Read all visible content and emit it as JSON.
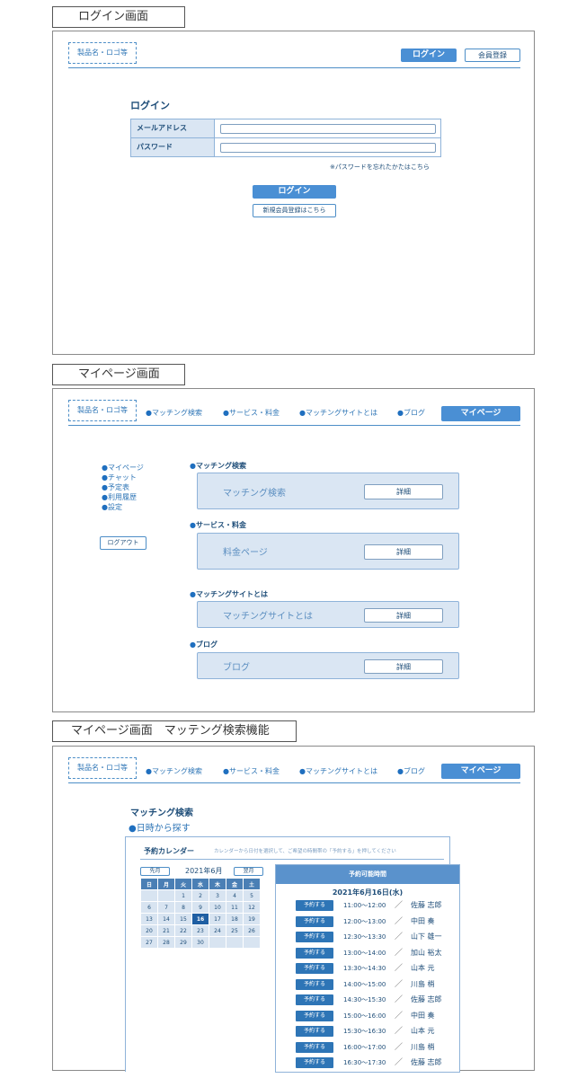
{
  "sections": {
    "login_title": "ログイン画面",
    "mypage_title": "マイページ画面",
    "search_title": "マイページ画面　マッテング検索機能"
  },
  "common": {
    "logo_text": "製品名・ロゴ等",
    "login_button": "ログイン",
    "register_button": "会員登録",
    "mypage_button": "マイページ",
    "nav": [
      "マッチング検索",
      "サービス・料金",
      "マッチングサイトとは",
      "ブログ"
    ]
  },
  "login": {
    "heading": "ログイン",
    "email_label": "メールアドレス",
    "email_value": "",
    "password_label": "パスワード",
    "password_value": "",
    "forgot_link": "※パスワードを忘れたかたはこちら",
    "submit": "ログイン",
    "signup": "新規会員登録はこちら"
  },
  "mypage": {
    "side_menu": [
      "マイページ",
      "チャット",
      "予定表",
      "利用履歴",
      "設定"
    ],
    "logout": "ログアウト",
    "detail_label": "詳細",
    "cards": [
      {
        "heading": "マッチング検索",
        "label": "マッチング検索"
      },
      {
        "heading": "サービス・料金",
        "label": "料金ページ"
      },
      {
        "heading": "マッチングサイトとは",
        "label": "マッチングサイトとは"
      },
      {
        "heading": "ブログ",
        "label": "ブログ"
      }
    ]
  },
  "search": {
    "heading": "マッチング検索",
    "subheading": "日時から探す",
    "calendar_title": "予約カレンダー",
    "calendar_hint": "カレンダーから日付を選択して、ご希望の時間帯の「予約する」を押してください",
    "prev_month": "先月",
    "month_label": "2021年6月",
    "next_month": "翌月",
    "weekdays": [
      "日",
      "月",
      "火",
      "水",
      "木",
      "金",
      "土"
    ],
    "weeks": [
      [
        "",
        "",
        "1",
        "2",
        "3",
        "4",
        "5"
      ],
      [
        "6",
        "7",
        "8",
        "9",
        "10",
        "11",
        "12"
      ],
      [
        "13",
        "14",
        "15",
        "16",
        "17",
        "18",
        "19"
      ],
      [
        "20",
        "21",
        "22",
        "23",
        "24",
        "25",
        "26"
      ],
      [
        "27",
        "28",
        "29",
        "30",
        "",
        "",
        ""
      ]
    ],
    "selected_day": "16",
    "avail_title": "予約可能時間",
    "avail_date": "2021年6月16日(水)",
    "reserve_label": "予約する",
    "separator": "／",
    "slots": [
      {
        "time": "11:00～12:00",
        "name": "佐藤 志郎"
      },
      {
        "time": "12:00～13:00",
        "name": "中田 奏"
      },
      {
        "time": "12:30～13:30",
        "name": "山下 雄一"
      },
      {
        "time": "13:00～14:00",
        "name": "加山 裕太"
      },
      {
        "time": "13:30～14:30",
        "name": "山本 元"
      },
      {
        "time": "14:00～15:00",
        "name": "川島 梢"
      },
      {
        "time": "14:30～15:30",
        "name": "佐藤 志郎"
      },
      {
        "time": "15:00～16:00",
        "name": "中田 奏"
      },
      {
        "time": "15:30～16:30",
        "name": "山本 元"
      },
      {
        "time": "16:00～17:00",
        "name": "川島 梢"
      },
      {
        "time": "16:30～17:30",
        "name": "佐藤 志郎"
      }
    ]
  }
}
